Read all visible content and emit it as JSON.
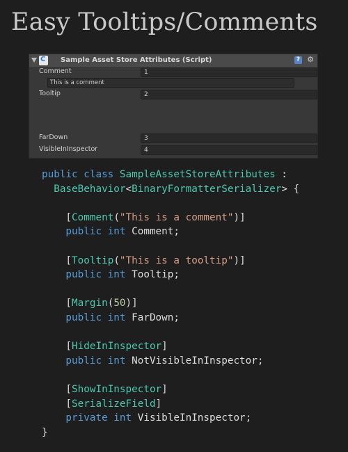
{
  "page_title": "Easy Tooltips/Comments",
  "inspector": {
    "title": "Sample Asset Store Attributes (Script)",
    "help_glyph": "?",
    "gear_glyph": "⚙",
    "fields": [
      {
        "label": "Comment",
        "value": "1",
        "comment": "This is a comment"
      },
      {
        "label": "Tooltip",
        "value": "2"
      },
      {
        "label": "FarDown",
        "value": "3"
      },
      {
        "label": "VisibleInInspector",
        "value": "4"
      }
    ]
  },
  "code": {
    "lines": [
      [
        {
          "t": "public class ",
          "c": "kw"
        },
        {
          "t": "SampleAssetStoreAttributes",
          "c": "ty"
        },
        {
          "t": " :",
          "c": "pl"
        }
      ],
      [
        {
          "t": "  ",
          "c": "pl"
        },
        {
          "t": "BaseBehavior",
          "c": "ty"
        },
        {
          "t": "<",
          "c": "pl"
        },
        {
          "t": "BinaryFormatterSerializer",
          "c": "ty"
        },
        {
          "t": "> {",
          "c": "pl"
        }
      ],
      [],
      [
        {
          "t": "    [",
          "c": "pl"
        },
        {
          "t": "Comment",
          "c": "ty"
        },
        {
          "t": "(",
          "c": "pl"
        },
        {
          "t": "\"This is a comment\"",
          "c": "str"
        },
        {
          "t": ")]",
          "c": "pl"
        }
      ],
      [
        {
          "t": "    public int ",
          "c": "kw"
        },
        {
          "t": "Comment;",
          "c": "pl"
        }
      ],
      [],
      [
        {
          "t": "    [",
          "c": "pl"
        },
        {
          "t": "Tooltip",
          "c": "ty"
        },
        {
          "t": "(",
          "c": "pl"
        },
        {
          "t": "\"This is a tooltip\"",
          "c": "str"
        },
        {
          "t": ")]",
          "c": "pl"
        }
      ],
      [
        {
          "t": "    public int ",
          "c": "kw"
        },
        {
          "t": "Tooltip;",
          "c": "pl"
        }
      ],
      [],
      [
        {
          "t": "    [",
          "c": "pl"
        },
        {
          "t": "Margin",
          "c": "ty"
        },
        {
          "t": "(",
          "c": "pl"
        },
        {
          "t": "50",
          "c": "num"
        },
        {
          "t": ")]",
          "c": "pl"
        }
      ],
      [
        {
          "t": "    public int ",
          "c": "kw"
        },
        {
          "t": "FarDown;",
          "c": "pl"
        }
      ],
      [],
      [
        {
          "t": "    [",
          "c": "pl"
        },
        {
          "t": "HideInInspector",
          "c": "ty"
        },
        {
          "t": "]",
          "c": "pl"
        }
      ],
      [
        {
          "t": "    public int ",
          "c": "kw"
        },
        {
          "t": "NotVisibleInInspector;",
          "c": "pl"
        }
      ],
      [],
      [
        {
          "t": "    [",
          "c": "pl"
        },
        {
          "t": "ShowInInspector",
          "c": "ty"
        },
        {
          "t": "]",
          "c": "pl"
        }
      ],
      [
        {
          "t": "    [",
          "c": "pl"
        },
        {
          "t": "SerializeField",
          "c": "ty"
        },
        {
          "t": "]",
          "c": "pl"
        }
      ],
      [
        {
          "t": "    private int ",
          "c": "kw"
        },
        {
          "t": "VisibleInInspector;",
          "c": "pl"
        }
      ],
      [
        {
          "t": "}",
          "c": "pl"
        }
      ]
    ]
  },
  "colors": {
    "background": "#1e1e1e",
    "keyword": "#569cd6",
    "type": "#4ec9b0",
    "string": "#d69d85",
    "number": "#b5cea8",
    "plain": "#dcdcdc"
  }
}
